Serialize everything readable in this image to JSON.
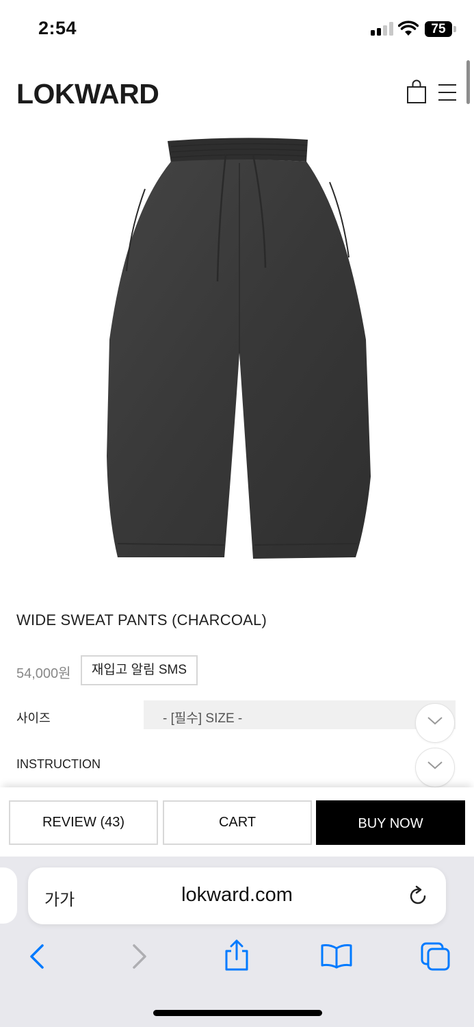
{
  "status_bar": {
    "time": "2:54",
    "battery": "75"
  },
  "header": {
    "logo": "LOKWARD"
  },
  "product": {
    "name": "WIDE SWEAT PANTS (CHARCOAL)",
    "price": "54,000원",
    "restock_button": "재입고 알림 SMS",
    "size_label": "사이즈",
    "size_placeholder": "- [필수] SIZE -",
    "instruction_label": "INSTRUCTION",
    "image_color": "#3b3b3b"
  },
  "actions": {
    "review": "REVIEW (43)",
    "cart": "CART",
    "buy_now": "BUY NOW"
  },
  "browser": {
    "text_size": "가가",
    "url": "lokward.com"
  },
  "colors": {
    "accent": "#007aff",
    "buy_bg": "#000000"
  }
}
